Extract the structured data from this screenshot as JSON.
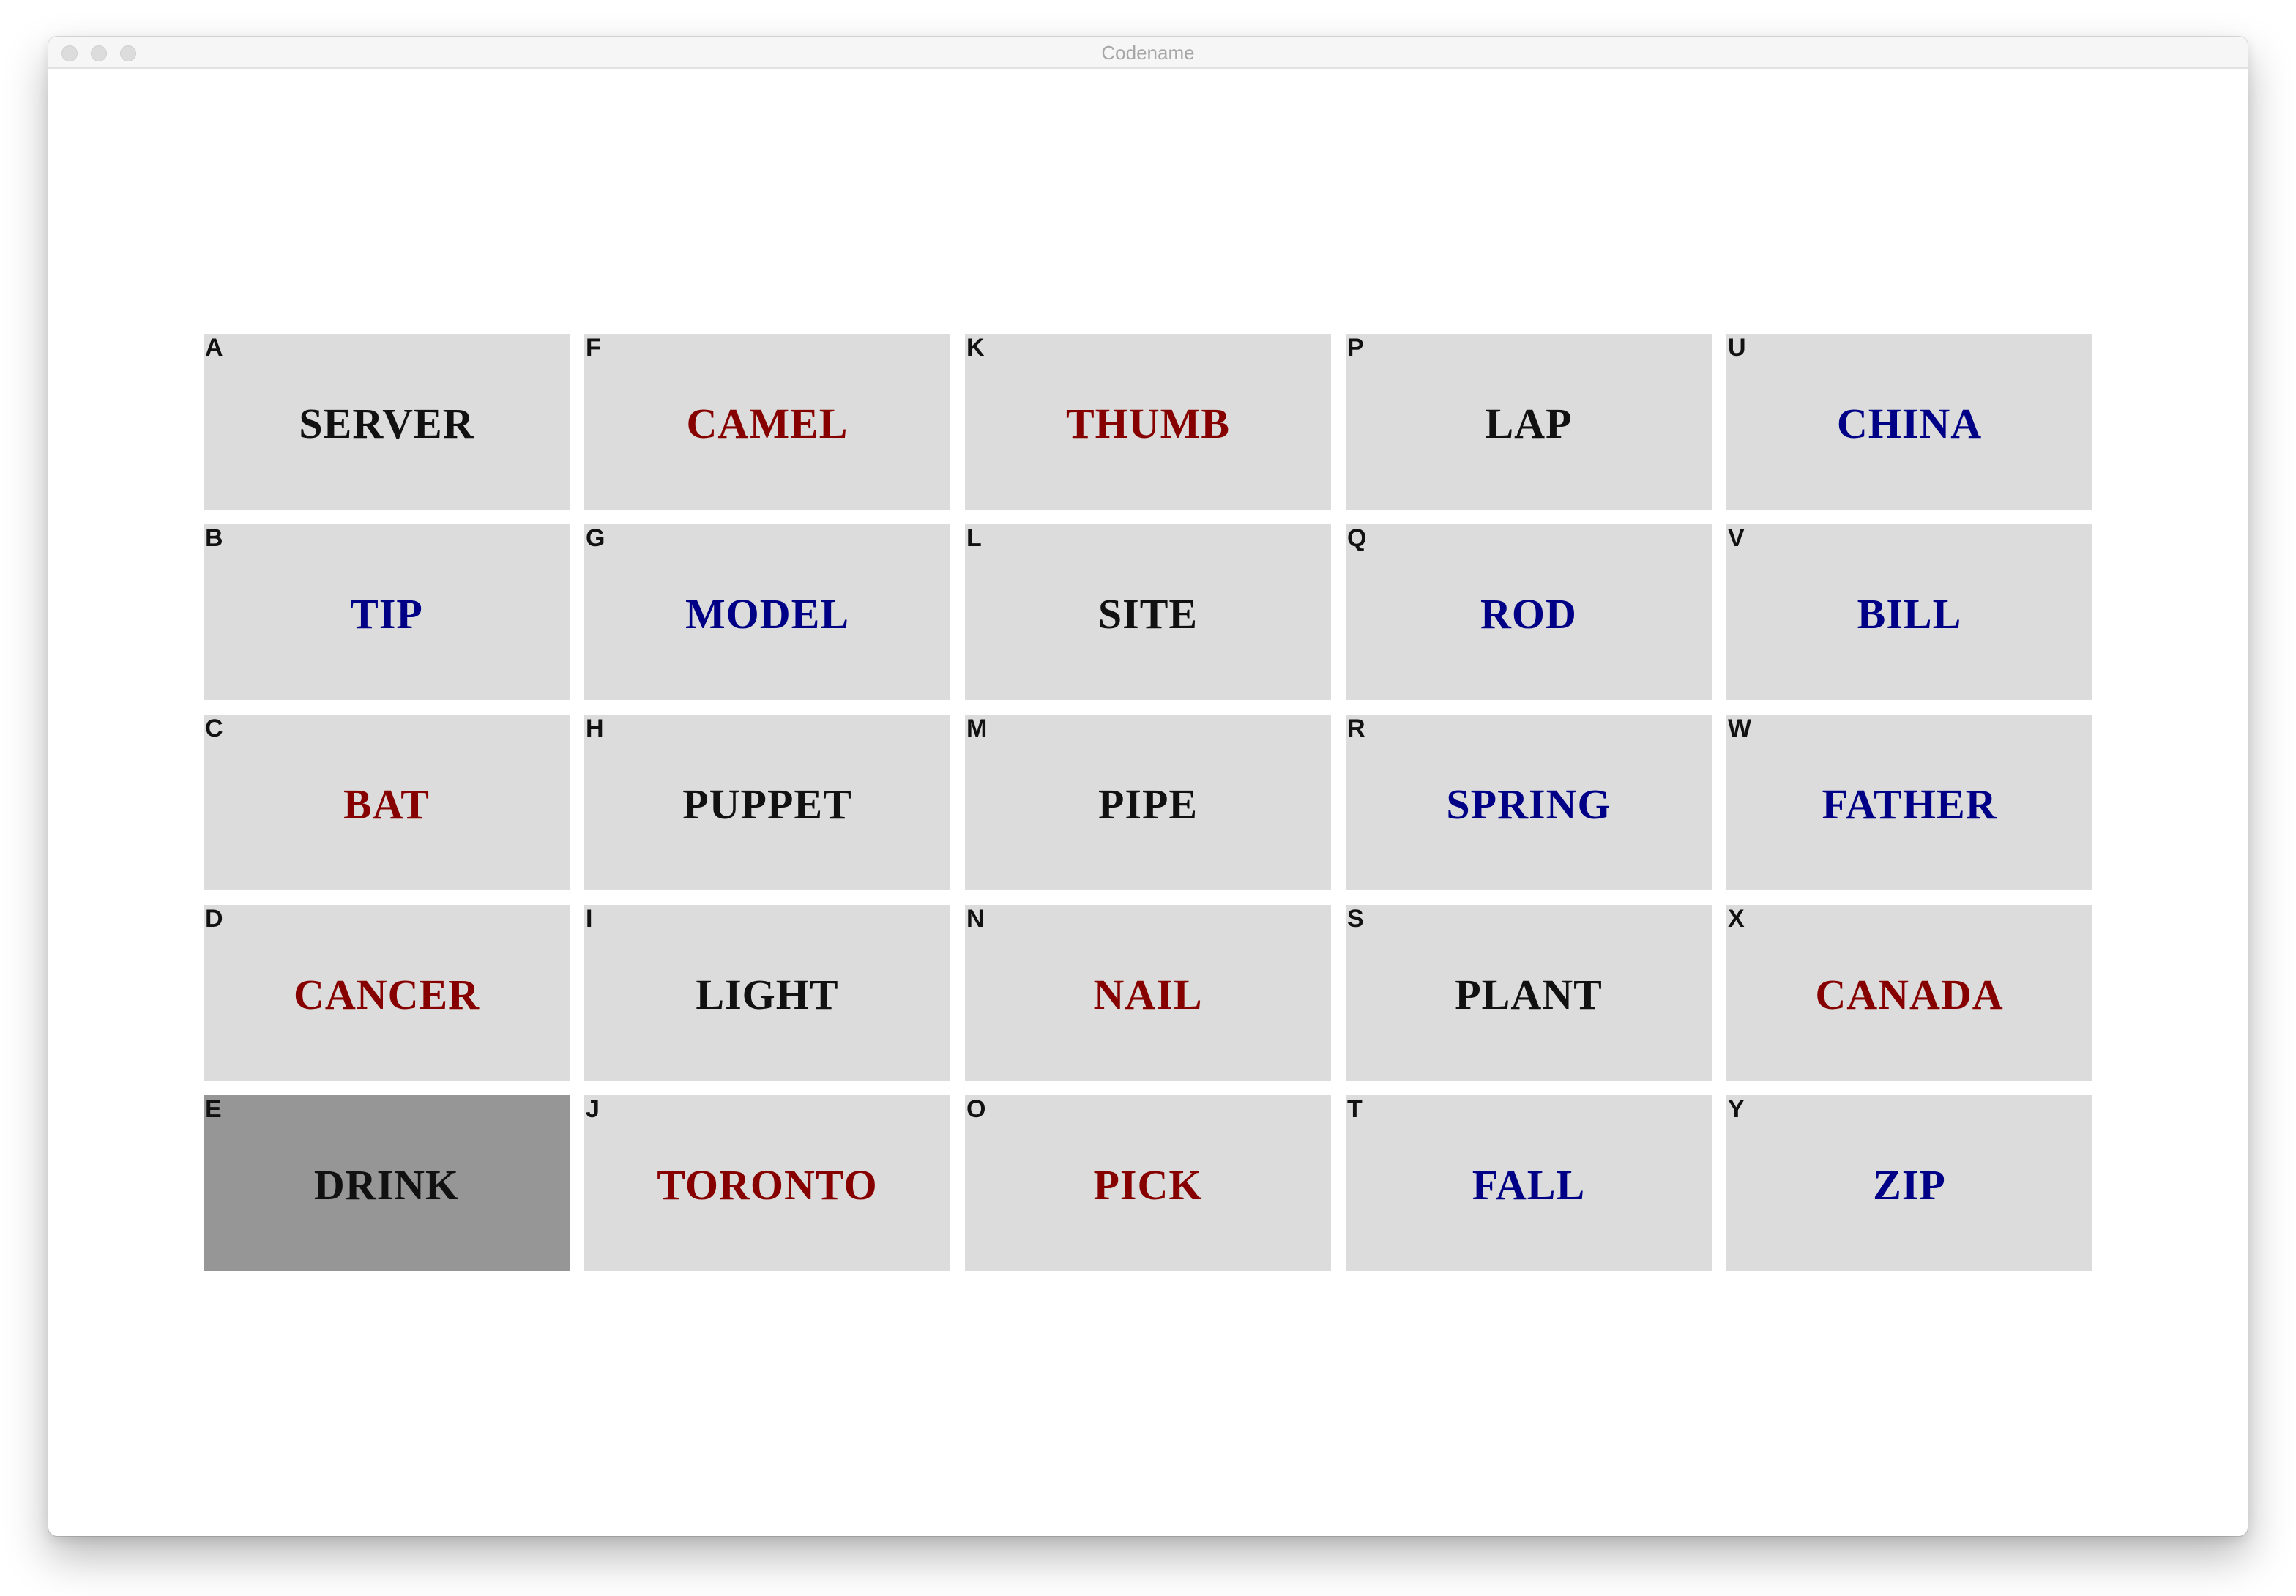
{
  "window": {
    "title": "Codename"
  },
  "colors": {
    "card_bg": "#dcdcdc",
    "card_selected_bg": "#969696",
    "black": "#111111",
    "red": "#870000",
    "blue": "#000087"
  },
  "board": {
    "cards": [
      {
        "letter": "A",
        "word": "SERVER",
        "color": "black"
      },
      {
        "letter": "F",
        "word": "CAMEL",
        "color": "red"
      },
      {
        "letter": "K",
        "word": "THUMB",
        "color": "red"
      },
      {
        "letter": "P",
        "word": "LAP",
        "color": "black"
      },
      {
        "letter": "U",
        "word": "CHINA",
        "color": "blue"
      },
      {
        "letter": "B",
        "word": "TIP",
        "color": "blue"
      },
      {
        "letter": "G",
        "word": "MODEL",
        "color": "blue"
      },
      {
        "letter": "L",
        "word": "SITE",
        "color": "black"
      },
      {
        "letter": "Q",
        "word": "ROD",
        "color": "blue"
      },
      {
        "letter": "V",
        "word": "BILL",
        "color": "blue"
      },
      {
        "letter": "C",
        "word": "BAT",
        "color": "red"
      },
      {
        "letter": "H",
        "word": "PUPPET",
        "color": "black"
      },
      {
        "letter": "M",
        "word": "PIPE",
        "color": "black"
      },
      {
        "letter": "R",
        "word": "SPRING",
        "color": "blue"
      },
      {
        "letter": "W",
        "word": "FATHER",
        "color": "blue"
      },
      {
        "letter": "D",
        "word": "CANCER",
        "color": "red"
      },
      {
        "letter": "I",
        "word": "LIGHT",
        "color": "black"
      },
      {
        "letter": "N",
        "word": "NAIL",
        "color": "red"
      },
      {
        "letter": "S",
        "word": "PLANT",
        "color": "black"
      },
      {
        "letter": "X",
        "word": "CANADA",
        "color": "red"
      },
      {
        "letter": "E",
        "word": "DRINK",
        "color": "black",
        "selected": true
      },
      {
        "letter": "J",
        "word": "TORONTO",
        "color": "red"
      },
      {
        "letter": "O",
        "word": "PICK",
        "color": "red"
      },
      {
        "letter": "T",
        "word": "FALL",
        "color": "blue"
      },
      {
        "letter": "Y",
        "word": "ZIP",
        "color": "blue"
      }
    ]
  }
}
